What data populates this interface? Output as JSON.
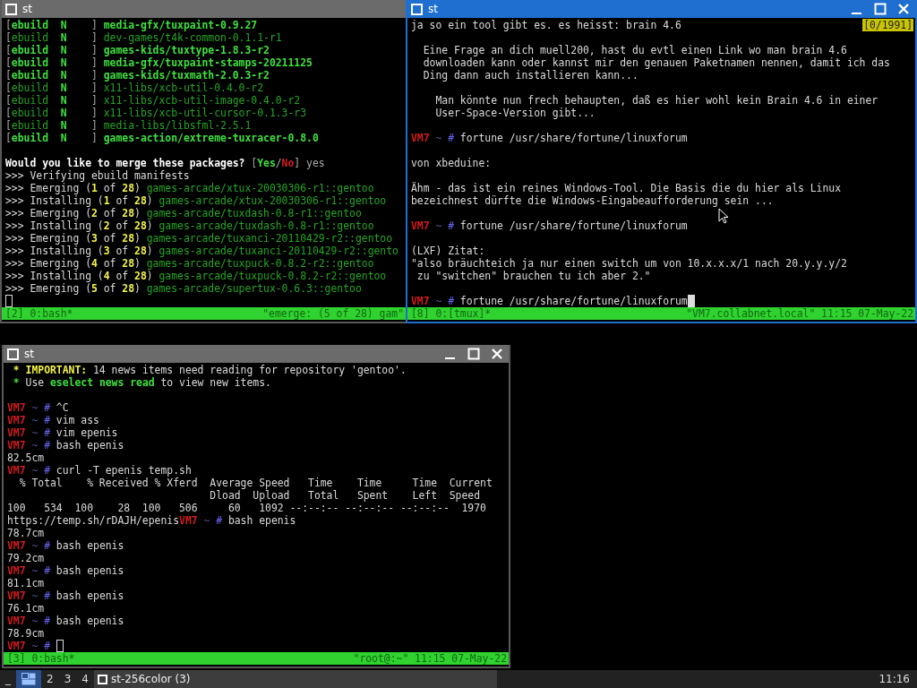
{
  "windows": [
    {
      "title": "st",
      "active": false,
      "controls": false,
      "lines": [
        {
          "segments": [
            {
              "text": "[",
              "kind": "gray"
            },
            {
              "text": "ebuild",
              "kind": "bold-green"
            },
            {
              "text": "  N",
              "kind": "bold-green"
            },
            {
              "text": "    ] ",
              "kind": "gray"
            },
            {
              "text": "media-gfx/tuxpaint-0.9.27",
              "kind": "bold-green"
            }
          ]
        },
        {
          "segments": [
            {
              "text": "[",
              "kind": "gray"
            },
            {
              "text": "ebuild",
              "kind": "green"
            },
            {
              "text": "  N",
              "kind": "bold-green"
            },
            {
              "text": "    ] ",
              "kind": "gray"
            },
            {
              "text": "dev-games/t4k-common-0.1.1-r1",
              "kind": "green"
            }
          ]
        },
        {
          "segments": [
            {
              "text": "[",
              "kind": "gray"
            },
            {
              "text": "ebuild",
              "kind": "bold-green"
            },
            {
              "text": "  N",
              "kind": "bold-green"
            },
            {
              "text": "    ] ",
              "kind": "gray"
            },
            {
              "text": "games-kids/tuxtype-1.8.3-r2",
              "kind": "bold-green"
            }
          ]
        },
        {
          "segments": [
            {
              "text": "[",
              "kind": "gray"
            },
            {
              "text": "ebuild",
              "kind": "bold-green"
            },
            {
              "text": "  N",
              "kind": "bold-green"
            },
            {
              "text": "    ] ",
              "kind": "gray"
            },
            {
              "text": "media-gfx/tuxpaint-stamps-20211125",
              "kind": "bold-green"
            }
          ]
        },
        {
          "segments": [
            {
              "text": "[",
              "kind": "gray"
            },
            {
              "text": "ebuild",
              "kind": "bold-green"
            },
            {
              "text": "  N",
              "kind": "bold-green"
            },
            {
              "text": "    ] ",
              "kind": "gray"
            },
            {
              "text": "games-kids/tuxmath-2.0.3-r2",
              "kind": "bold-green"
            }
          ]
        },
        {
          "segments": [
            {
              "text": "[",
              "kind": "gray"
            },
            {
              "text": "ebuild",
              "kind": "green"
            },
            {
              "text": "  N",
              "kind": "bold-green"
            },
            {
              "text": "    ] ",
              "kind": "gray"
            },
            {
              "text": "x11-libs/xcb-util-0.4.0-r2",
              "kind": "green"
            }
          ]
        },
        {
          "segments": [
            {
              "text": "[",
              "kind": "gray"
            },
            {
              "text": "ebuild",
              "kind": "green"
            },
            {
              "text": "  N",
              "kind": "bold-green"
            },
            {
              "text": "    ] ",
              "kind": "gray"
            },
            {
              "text": "x11-libs/xcb-util-image-0.4.0-r2",
              "kind": "green"
            }
          ]
        },
        {
          "segments": [
            {
              "text": "[",
              "kind": "gray"
            },
            {
              "text": "ebuild",
              "kind": "green"
            },
            {
              "text": "  N",
              "kind": "bold-green"
            },
            {
              "text": "    ] ",
              "kind": "gray"
            },
            {
              "text": "x11-libs/xcb-util-cursor-0.1.3-r3",
              "kind": "green"
            }
          ]
        },
        {
          "segments": [
            {
              "text": "[",
              "kind": "gray"
            },
            {
              "text": "ebuild",
              "kind": "green"
            },
            {
              "text": "  N",
              "kind": "bold-green"
            },
            {
              "text": "    ] ",
              "kind": "gray"
            },
            {
              "text": "media-libs/libsfml-2.5.1",
              "kind": "green"
            }
          ]
        },
        {
          "segments": [
            {
              "text": "[",
              "kind": "gray"
            },
            {
              "text": "ebuild",
              "kind": "bold-green"
            },
            {
              "text": "  N",
              "kind": "bold-green"
            },
            {
              "text": "    ] ",
              "kind": "gray"
            },
            {
              "text": "games-action/extreme-tuxracer-0.8.0",
              "kind": "bold-green"
            }
          ]
        },
        {
          "kind": "blank"
        },
        {
          "segments": [
            {
              "text": "Would you like to merge these packages? ",
              "kind": "bold-white"
            },
            {
              "text": "[",
              "kind": "gray"
            },
            {
              "text": "Yes",
              "kind": "bold-green"
            },
            {
              "text": "/",
              "kind": "gray"
            },
            {
              "text": "No",
              "kind": "red"
            },
            {
              "text": "] yes",
              "kind": "gray"
            }
          ]
        },
        {
          "segments": [
            {
              "text": ">>> Verifying ebuild manifests",
              "kind": "white"
            }
          ]
        },
        {
          "segments": [
            {
              "text": ">>> Emerging (",
              "kind": "white"
            },
            {
              "text": "1",
              "kind": "yellow"
            },
            {
              "text": " of ",
              "kind": "white"
            },
            {
              "text": "28",
              "kind": "yellow"
            },
            {
              "text": ") ",
              "kind": "white"
            },
            {
              "text": "games-arcade/xtux-20030306-r1::gentoo",
              "kind": "green"
            }
          ]
        },
        {
          "segments": [
            {
              "text": ">>> Installing (",
              "kind": "white"
            },
            {
              "text": "1",
              "kind": "yellow"
            },
            {
              "text": " of ",
              "kind": "white"
            },
            {
              "text": "28",
              "kind": "yellow"
            },
            {
              "text": ") ",
              "kind": "white"
            },
            {
              "text": "games-arcade/xtux-20030306-r1::gentoo",
              "kind": "green"
            }
          ]
        },
        {
          "segments": [
            {
              "text": ">>> Emerging (",
              "kind": "white"
            },
            {
              "text": "2",
              "kind": "yellow"
            },
            {
              "text": " of ",
              "kind": "white"
            },
            {
              "text": "28",
              "kind": "yellow"
            },
            {
              "text": ") ",
              "kind": "white"
            },
            {
              "text": "games-arcade/tuxdash-0.8-r1::gentoo",
              "kind": "green"
            }
          ]
        },
        {
          "segments": [
            {
              "text": ">>> Installing (",
              "kind": "white"
            },
            {
              "text": "2",
              "kind": "yellow"
            },
            {
              "text": " of ",
              "kind": "white"
            },
            {
              "text": "28",
              "kind": "yellow"
            },
            {
              "text": ") ",
              "kind": "white"
            },
            {
              "text": "games-arcade/tuxdash-0.8-r1::gentoo",
              "kind": "green"
            }
          ]
        },
        {
          "segments": [
            {
              "text": ">>> Emerging (",
              "kind": "white"
            },
            {
              "text": "3",
              "kind": "yellow"
            },
            {
              "text": " of ",
              "kind": "white"
            },
            {
              "text": "28",
              "kind": "yellow"
            },
            {
              "text": ") ",
              "kind": "white"
            },
            {
              "text": "games-arcade/tuxanci-20110429-r2::gentoo",
              "kind": "green"
            }
          ]
        },
        {
          "segments": [
            {
              "text": ">>> Installing (",
              "kind": "white"
            },
            {
              "text": "3",
              "kind": "yellow"
            },
            {
              "text": " of ",
              "kind": "white"
            },
            {
              "text": "28",
              "kind": "yellow"
            },
            {
              "text": ") ",
              "kind": "white"
            },
            {
              "text": "games-arcade/tuxanci-20110429-r2::gento",
              "kind": "green"
            }
          ]
        },
        {
          "segments": [
            {
              "text": ">>> Emerging (",
              "kind": "white"
            },
            {
              "text": "4",
              "kind": "yellow"
            },
            {
              "text": " of ",
              "kind": "white"
            },
            {
              "text": "28",
              "kind": "yellow"
            },
            {
              "text": ") ",
              "kind": "white"
            },
            {
              "text": "games-arcade/tuxpuck-0.8.2-r2::gentoo",
              "kind": "green"
            }
          ]
        },
        {
          "segments": [
            {
              "text": ">>> Installing (",
              "kind": "white"
            },
            {
              "text": "4",
              "kind": "yellow"
            },
            {
              "text": " of ",
              "kind": "white"
            },
            {
              "text": "28",
              "kind": "yellow"
            },
            {
              "text": ") ",
              "kind": "white"
            },
            {
              "text": "games-arcade/tuxpuck-0.8.2-r2::gentoo",
              "kind": "green"
            }
          ]
        },
        {
          "segments": [
            {
              "text": ">>> Emerging (",
              "kind": "white"
            },
            {
              "text": "5",
              "kind": "yellow"
            },
            {
              "text": " of ",
              "kind": "white"
            },
            {
              "text": "28",
              "kind": "yellow"
            },
            {
              "text": ") ",
              "kind": "white"
            },
            {
              "text": "games-arcade/supertux-0.6.3::gentoo",
              "kind": "green"
            }
          ]
        },
        {
          "segments": [
            {
              "kind": "cursor",
              "filled": false
            }
          ]
        }
      ],
      "status": {
        "left": "[2] 0:bash*",
        "right": "\"emerge: (5 of 28) gam\""
      }
    },
    {
      "title": "st",
      "active": true,
      "controls": true,
      "badge": "[0/1991]",
      "lines": [
        {
          "segments": [
            {
              "text": "ja so ein tool gibt es. es heisst: brain 4.6",
              "kind": "white"
            }
          ]
        },
        {
          "kind": "blank"
        },
        {
          "segments": [
            {
              "text": "  Eine Frage an dich muell200, hast du evtl einen Link wo man brain 4.6",
              "kind": "white"
            }
          ]
        },
        {
          "segments": [
            {
              "text": "  downloaden kann oder kannst mir den genauen Paketnamen nennen, damit ich das",
              "kind": "white"
            }
          ]
        },
        {
          "segments": [
            {
              "text": "  Ding dann auch installieren kann...",
              "kind": "white"
            }
          ]
        },
        {
          "kind": "blank"
        },
        {
          "segments": [
            {
              "text": "    Man könnte nun frech behaupten, daß es hier wohl kein Brain 4.6 in einer",
              "kind": "white"
            }
          ]
        },
        {
          "segments": [
            {
              "text": "    User-Space-Version gibt...",
              "kind": "white"
            }
          ]
        },
        {
          "kind": "blank"
        },
        {
          "segments": [
            {
              "text": "VM7",
              "kind": "red"
            },
            {
              "text": " ~ ",
              "kind": "dim-blue"
            },
            {
              "text": "#",
              "kind": "blue"
            },
            {
              "text": " fortune /usr/share/fortune/linuxforum",
              "kind": "white"
            }
          ]
        },
        {
          "kind": "blank"
        },
        {
          "segments": [
            {
              "text": "von xbeduine:",
              "kind": "white"
            }
          ]
        },
        {
          "kind": "blank"
        },
        {
          "segments": [
            {
              "text": "Ähm - das ist ein reines Windows-Tool. Die Basis die du hier als Linux",
              "kind": "white"
            }
          ]
        },
        {
          "segments": [
            {
              "text": "bezeichnest dürfte die Windows-Eingabeaufforderung sein ...",
              "kind": "white"
            }
          ]
        },
        {
          "kind": "blank"
        },
        {
          "segments": [
            {
              "text": "VM7",
              "kind": "red"
            },
            {
              "text": " ~ ",
              "kind": "dim-blue"
            },
            {
              "text": "#",
              "kind": "blue"
            },
            {
              "text": " fortune /usr/share/fortune/linuxforum",
              "kind": "white"
            }
          ]
        },
        {
          "kind": "blank"
        },
        {
          "segments": [
            {
              "text": "(LXF) Zitat:",
              "kind": "white"
            }
          ]
        },
        {
          "segments": [
            {
              "text": "\"also bräuchteich ja nur einen switch um von 10.x.x.x/1 nach 20.y.y.y/2",
              "kind": "white"
            }
          ]
        },
        {
          "segments": [
            {
              "text": " zu \"switchen\" brauchen tu ich aber 2.\"",
              "kind": "white"
            }
          ]
        },
        {
          "kind": "blank"
        },
        {
          "segments": [
            {
              "text": "VM7",
              "kind": "red"
            },
            {
              "text": " ~ ",
              "kind": "dim-blue"
            },
            {
              "text": "#",
              "kind": "blue"
            },
            {
              "text": " fortune /usr/share/fortune/linuxforum",
              "kind": "white"
            },
            {
              "kind": "cursor",
              "filled": true
            }
          ]
        }
      ],
      "status": {
        "left": "[8] 0:[tmux]*",
        "right": "\"VM7.collabnet.local\" 11:15 07-May-22"
      }
    },
    {
      "title": "st",
      "active": false,
      "controls": true,
      "lines": [
        {
          "segments": [
            {
              "text": " * ",
              "kind": "yellow"
            },
            {
              "text": "IMPORTANT:",
              "kind": "yellow"
            },
            {
              "text": " 14 news items need reading for repository 'gentoo'.",
              "kind": "white"
            }
          ]
        },
        {
          "segments": [
            {
              "text": " * ",
              "kind": "bold-green"
            },
            {
              "text": "Use ",
              "kind": "white"
            },
            {
              "text": "eselect news read",
              "kind": "bold-green"
            },
            {
              "text": " to view new items.",
              "kind": "white"
            }
          ]
        },
        {
          "kind": "blank"
        },
        {
          "segments": [
            {
              "text": "VM7",
              "kind": "red"
            },
            {
              "text": " ~ ",
              "kind": "dim-blue"
            },
            {
              "text": "#",
              "kind": "blue"
            },
            {
              "text": " ^C",
              "kind": "white"
            }
          ]
        },
        {
          "segments": [
            {
              "text": "VM7",
              "kind": "red"
            },
            {
              "text": " ~ ",
              "kind": "dim-blue"
            },
            {
              "text": "#",
              "kind": "blue"
            },
            {
              "text": " vim ass",
              "kind": "white"
            }
          ]
        },
        {
          "segments": [
            {
              "text": "VM7",
              "kind": "red"
            },
            {
              "text": " ~ ",
              "kind": "dim-blue"
            },
            {
              "text": "#",
              "kind": "blue"
            },
            {
              "text": " vim epenis",
              "kind": "white"
            }
          ]
        },
        {
          "segments": [
            {
              "text": "VM7",
              "kind": "red"
            },
            {
              "text": " ~ ",
              "kind": "dim-blue"
            },
            {
              "text": "#",
              "kind": "blue"
            },
            {
              "text": " bash epenis",
              "kind": "white"
            }
          ]
        },
        {
          "segments": [
            {
              "text": "82.5cm",
              "kind": "white"
            }
          ]
        },
        {
          "segments": [
            {
              "text": "VM7",
              "kind": "red"
            },
            {
              "text": " ~ ",
              "kind": "dim-blue"
            },
            {
              "text": "#",
              "kind": "blue"
            },
            {
              "text": " curl -T epenis temp.sh",
              "kind": "white"
            }
          ]
        },
        {
          "segments": [
            {
              "text": "  % Total    % Received % Xferd  Average Speed   Time    Time     Time  Current",
              "kind": "white"
            }
          ]
        },
        {
          "segments": [
            {
              "text": "                                 Dload  Upload   Total   Spent    Left  Speed",
              "kind": "white"
            }
          ]
        },
        {
          "segments": [
            {
              "text": "100   534  100    28  100   506     60   1092 --:--:-- --:--:-- --:--:--  1970",
              "kind": "white"
            }
          ]
        },
        {
          "segments": [
            {
              "text": "https://temp.sh/rDAJH/epenis",
              "kind": "white"
            },
            {
              "text": "VM7",
              "kind": "red"
            },
            {
              "text": " ~ ",
              "kind": "dim-blue"
            },
            {
              "text": "#",
              "kind": "blue"
            },
            {
              "text": " bash epenis",
              "kind": "white"
            }
          ]
        },
        {
          "segments": [
            {
              "text": "78.7cm",
              "kind": "white"
            }
          ]
        },
        {
          "segments": [
            {
              "text": "VM7",
              "kind": "red"
            },
            {
              "text": " ~ ",
              "kind": "dim-blue"
            },
            {
              "text": "#",
              "kind": "blue"
            },
            {
              "text": " bash epenis",
              "kind": "white"
            }
          ]
        },
        {
          "segments": [
            {
              "text": "79.2cm",
              "kind": "white"
            }
          ]
        },
        {
          "segments": [
            {
              "text": "VM7",
              "kind": "red"
            },
            {
              "text": " ~ ",
              "kind": "dim-blue"
            },
            {
              "text": "#",
              "kind": "blue"
            },
            {
              "text": " bash epenis",
              "kind": "white"
            }
          ]
        },
        {
          "segments": [
            {
              "text": "81.1cm",
              "kind": "white"
            }
          ]
        },
        {
          "segments": [
            {
              "text": "VM7",
              "kind": "red"
            },
            {
              "text": " ~ ",
              "kind": "dim-blue"
            },
            {
              "text": "#",
              "kind": "blue"
            },
            {
              "text": " bash epenis",
              "kind": "white"
            }
          ]
        },
        {
          "segments": [
            {
              "text": "76.1cm",
              "kind": "white"
            }
          ]
        },
        {
          "segments": [
            {
              "text": "VM7",
              "kind": "red"
            },
            {
              "text": " ~ ",
              "kind": "dim-blue"
            },
            {
              "text": "#",
              "kind": "blue"
            },
            {
              "text": " bash epenis",
              "kind": "white"
            }
          ]
        },
        {
          "segments": [
            {
              "text": "78.9cm",
              "kind": "white"
            }
          ]
        },
        {
          "segments": [
            {
              "text": "VM7",
              "kind": "red"
            },
            {
              "text": " ~ ",
              "kind": "dim-blue"
            },
            {
              "text": "# ",
              "kind": "blue"
            },
            {
              "kind": "cursor",
              "filled": false
            }
          ]
        }
      ],
      "status": {
        "left": "[3] 0:bash*",
        "right": "\"root@:~\" 11:15 07-May-22"
      }
    }
  ],
  "taskbar": {
    "menu": "_",
    "workspaces": [
      {
        "kind": "icon",
        "selected": true
      },
      {
        "kind": "number",
        "label": "2",
        "selected": false
      },
      {
        "kind": "number",
        "label": "3",
        "selected": false
      },
      {
        "kind": "number",
        "label": "4",
        "selected": false
      }
    ],
    "task": "st-256color (3)",
    "clock": "11:16"
  }
}
